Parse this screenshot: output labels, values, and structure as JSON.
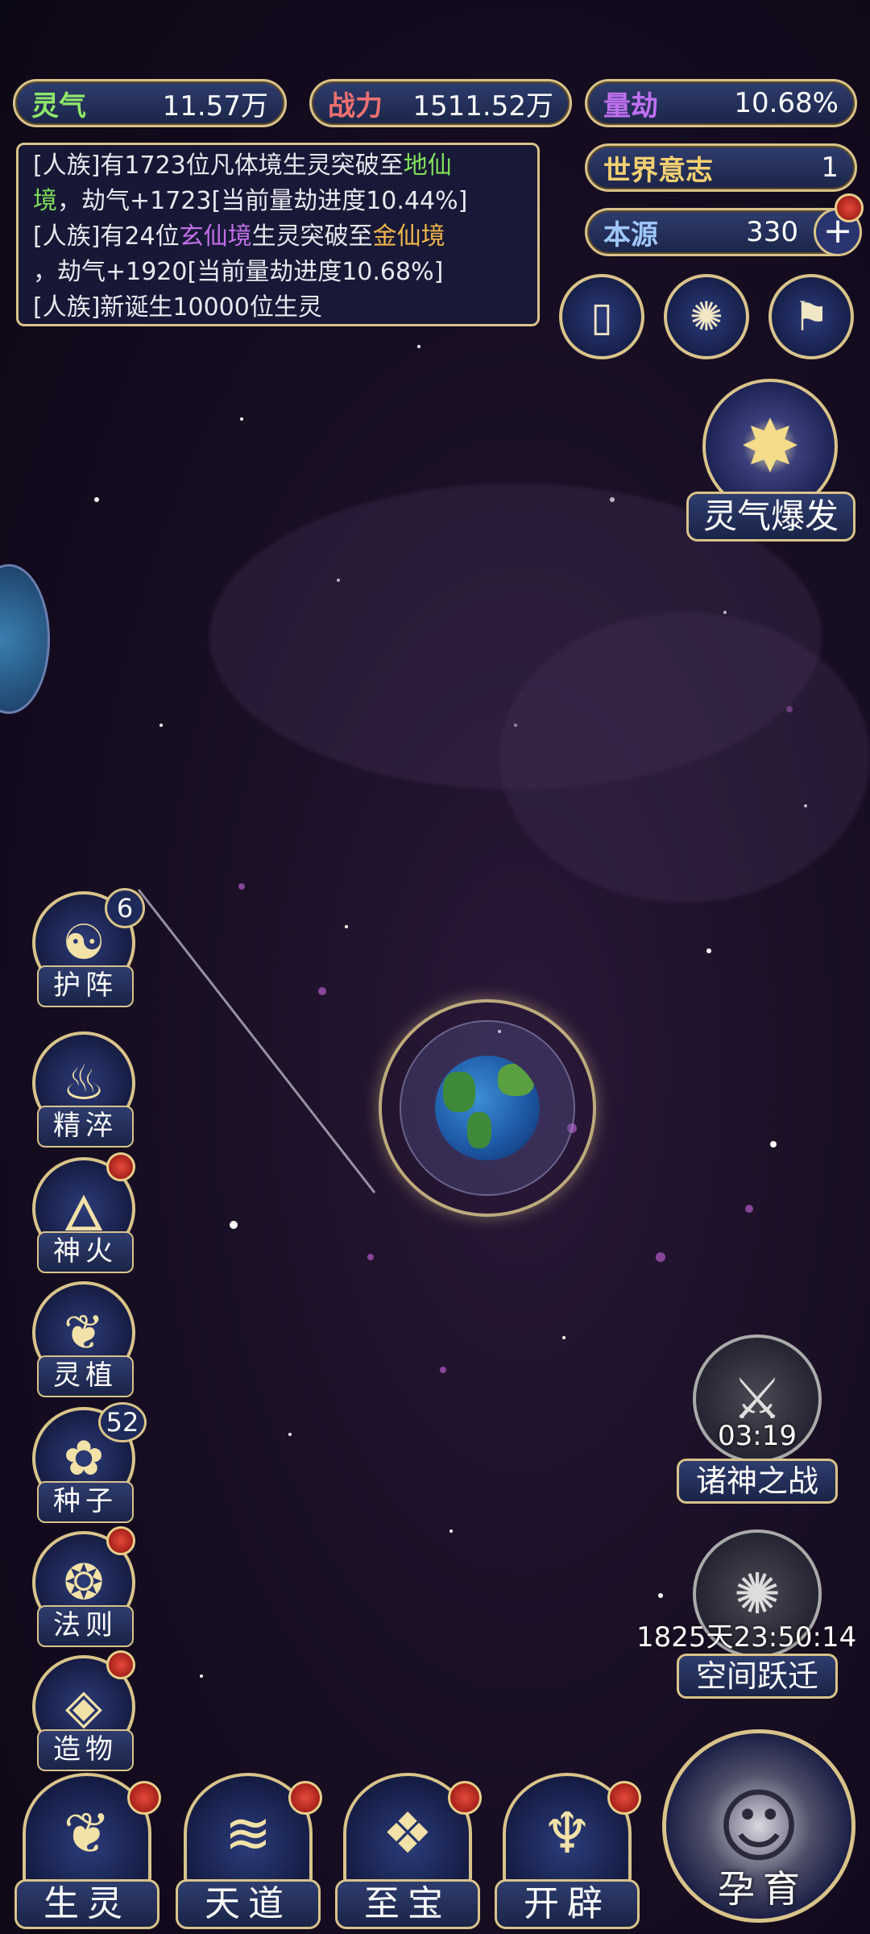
{
  "stats": {
    "lingqi": {
      "label": "灵气",
      "value": "11.57万"
    },
    "zhanli": {
      "label": "战力",
      "value": "1511.52万"
    },
    "liangjie": {
      "label": "量劫",
      "value": "10.68%"
    },
    "shijie_yizhi": {
      "label": "世界意志",
      "value": "1"
    },
    "benyuan": {
      "label": "本源",
      "value": "330"
    }
  },
  "log": [
    {
      "a": "[人族]有1723位凡体境生灵突破至",
      "b": "地仙",
      "c": "境",
      "d": "，劫气+1723[当前量劫进度10.44%]"
    },
    {
      "a": "[人族]有24位",
      "b": "玄仙境",
      "c": "生灵突破至",
      "d": "金仙境",
      "e": "，劫气+1920[当前量劫进度10.68%]"
    },
    {
      "a": "[人族]新诞生10000位生灵"
    }
  ],
  "burst": {
    "label": "灵气爆发"
  },
  "side_menu": [
    {
      "label": "护阵",
      "badge": "6"
    },
    {
      "label": "精淬"
    },
    {
      "label": "神火"
    },
    {
      "label": "灵植"
    },
    {
      "label": "种子",
      "badge": "52"
    },
    {
      "label": "法则"
    },
    {
      "label": "造物"
    }
  ],
  "right_buttons": {
    "war": {
      "label": "诸神之战",
      "timer": "03:19"
    },
    "leap": {
      "label": "空间跃迁",
      "timer": "1825天23:50:14"
    }
  },
  "bottom_nav": [
    {
      "label": "生灵"
    },
    {
      "label": "天道"
    },
    {
      "label": "至宝"
    },
    {
      "label": "开辟"
    },
    {
      "label": "孕育"
    }
  ],
  "colors": {
    "gold_border": "#d9c38a",
    "lingqi_label": "#8ee86a",
    "zhanli_label": "#f07070",
    "liangjie_label": "#c070f0",
    "shijie_label": "#f4d070",
    "benyuan_label": "#a0c8ff"
  }
}
